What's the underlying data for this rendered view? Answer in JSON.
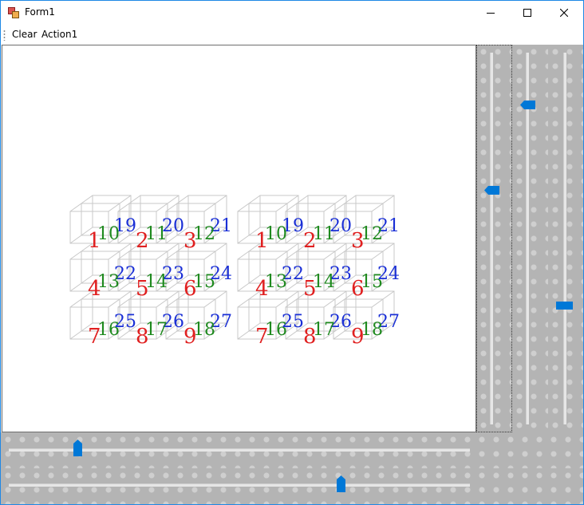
{
  "window": {
    "title": "Form1",
    "controls": [
      "minimize-icon",
      "maximize-icon",
      "close-icon"
    ]
  },
  "menu": {
    "items": [
      "Clear",
      "Action1"
    ]
  },
  "scene": {
    "cube_sets": [
      {
        "front_labels": [
          "1",
          "2",
          "3",
          "4",
          "5",
          "6",
          "7",
          "8",
          "9"
        ],
        "middle_labels": [
          "10",
          "11",
          "12",
          "13",
          "14",
          "15",
          "16",
          "17",
          "18"
        ],
        "back_labels": [
          "19",
          "20",
          "21",
          "22",
          "23",
          "24",
          "25",
          "26",
          "27"
        ]
      },
      {
        "front_labels": [
          "1",
          "2",
          "3",
          "4",
          "5",
          "6",
          "7",
          "8",
          "9"
        ],
        "middle_labels": [
          "10",
          "11",
          "12",
          "13",
          "14",
          "15",
          "16",
          "17",
          "18"
        ],
        "back_labels": [
          "19",
          "20",
          "21",
          "22",
          "23",
          "24",
          "25",
          "26",
          "27"
        ]
      }
    ],
    "colors": {
      "front": "#e02020",
      "middle": "#1f8a1f",
      "back": "#1a2fd6",
      "wire": "#c8c8c8"
    }
  },
  "trackbars": {
    "vertical": [
      {
        "name": "trackbar-vertical-1",
        "value": 0.36
      },
      {
        "name": "trackbar-vertical-2",
        "value": 0.13
      },
      {
        "name": "trackbar-vertical-3",
        "value": 0.67
      }
    ],
    "horizontal": [
      {
        "name": "trackbar-horizontal-1",
        "value": 0.15
      },
      {
        "name": "trackbar-horizontal-2",
        "value": 0.72
      }
    ]
  },
  "colors": {
    "accent": "#0078d7",
    "track_bg": "#b4b4b4"
  }
}
